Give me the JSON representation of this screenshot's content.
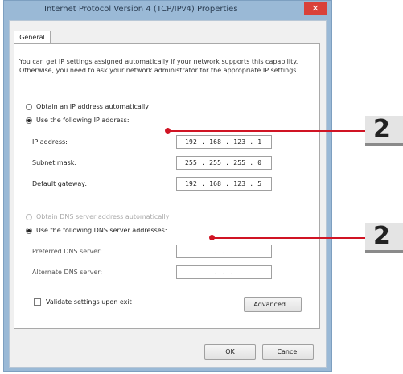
{
  "window": {
    "title": "Internet Protocol Version 4 (TCP/IPv4) Properties",
    "close_glyph": "✕"
  },
  "tabs": [
    {
      "label": "General"
    }
  ],
  "intro_text": "You can get IP settings assigned automatically if your network supports this capability. Otherwise, you need to ask your network administrator for the appropriate IP settings.",
  "ip_section": {
    "auto_option": "Obtain an IP address automatically",
    "manual_option": "Use the following IP address:",
    "selected": "manual",
    "fields": [
      {
        "label": "IP address:",
        "value": "192 . 168 . 123 .   1"
      },
      {
        "label": "Subnet mask:",
        "value": "255 . 255 . 255 .   0"
      },
      {
        "label": "Default gateway:",
        "value": "192 . 168 . 123 .   5"
      }
    ]
  },
  "dns_section": {
    "auto_option": "Obtain DNS server address automatically",
    "manual_option": "Use the following DNS server addresses:",
    "selected": "manual",
    "fields": [
      {
        "label": "Preferred DNS server:",
        "value": ".     .     ."
      },
      {
        "label": "Alternate DNS server:",
        "value": ".     .     ."
      }
    ]
  },
  "validate_label": "Validate settings upon exit",
  "buttons": {
    "advanced": "Advanced...",
    "ok": "OK",
    "cancel": "Cancel"
  },
  "callouts": [
    {
      "number": "2"
    },
    {
      "number": "2"
    }
  ],
  "colors": {
    "callout_line": "#d01424",
    "title_bar": "#9ab9d6",
    "close_button": "#d9413a"
  }
}
